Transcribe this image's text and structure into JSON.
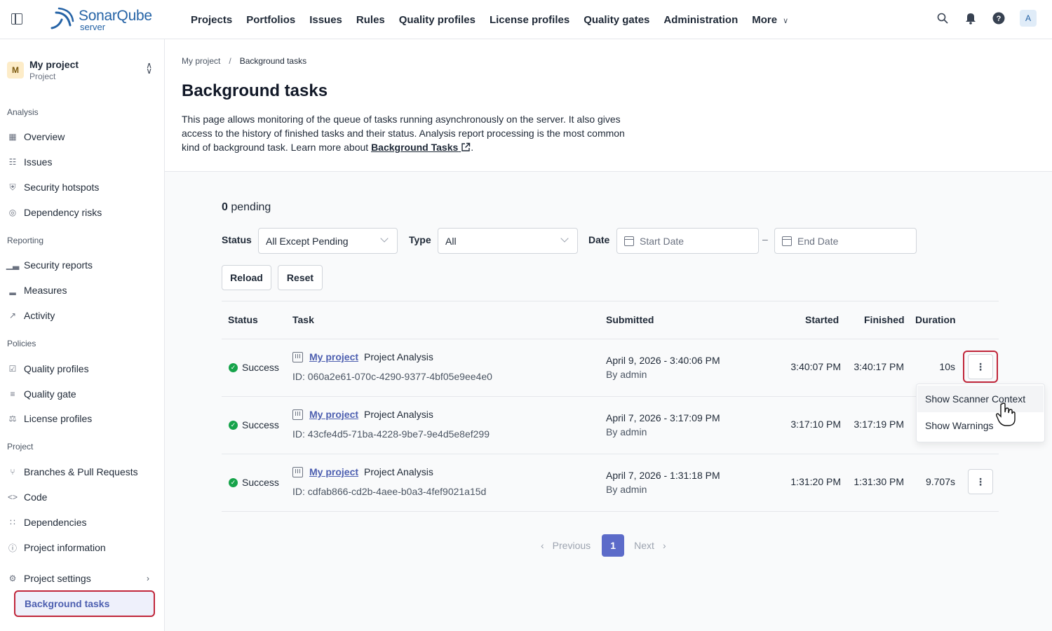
{
  "app": {
    "name": "SonarQube",
    "sub": "server",
    "brand_color": "#2563a6"
  },
  "nav": {
    "items": [
      "Projects",
      "Portfolios",
      "Issues",
      "Rules",
      "Quality profiles",
      "License profiles",
      "Quality gates",
      "Administration"
    ],
    "more": "More",
    "icons": [
      "search-icon",
      "bell-icon",
      "help-icon"
    ],
    "avatar": "A"
  },
  "project": {
    "avatar": "M",
    "name": "My project",
    "type": "Project"
  },
  "sidebar": {
    "sections": {
      "analysis": "Analysis",
      "reporting": "Reporting",
      "policies": "Policies",
      "project": "Project"
    },
    "items": {
      "overview": "Overview",
      "issues": "Issues",
      "hotspots": "Security hotspots",
      "dependency_risks": "Dependency risks",
      "security_reports": "Security reports",
      "measures": "Measures",
      "activity": "Activity",
      "quality_profiles": "Quality profiles",
      "quality_gate": "Quality gate",
      "license_profiles": "License profiles",
      "branches": "Branches & Pull Requests",
      "code": "Code",
      "dependencies": "Dependencies",
      "project_information": "Project information",
      "project_settings": "Project settings",
      "background_tasks": "Background tasks"
    }
  },
  "breadcrumb": {
    "root": "My project",
    "sep": "/",
    "current": "Background tasks"
  },
  "page": {
    "title": "Background tasks",
    "desc": "This page allows monitoring of the queue of tasks running asynchronously on the server. It also gives access to the history of finished tasks and their status. Analysis report processing is the most common kind of background task. Learn more about ",
    "desc_link": "Background Tasks",
    "desc_end": "."
  },
  "filters": {
    "pending_count": "0",
    "pending_label": "pending",
    "status_label": "Status",
    "status_value": "All Except Pending",
    "type_label": "Type",
    "type_value": "All",
    "date_label": "Date",
    "start_placeholder": "Start Date",
    "dash": "–",
    "end_placeholder": "End Date",
    "reload": "Reload",
    "reset": "Reset"
  },
  "table": {
    "headers": {
      "status": "Status",
      "task": "Task",
      "submitted": "Submitted",
      "started": "Started",
      "finished": "Finished",
      "duration": "Duration"
    },
    "rows": [
      {
        "status": "Success",
        "project": "My project",
        "task": "Project Analysis",
        "id": "ID: 060a2e61-070c-4290-9377-4bf05e9ee4e0",
        "submitted": "April 9, 2026 - 3:40:06 PM",
        "by": "By admin",
        "started": "3:40:07 PM",
        "finished": "3:40:17 PM",
        "duration": "10s"
      },
      {
        "status": "Success",
        "project": "My project",
        "task": "Project Analysis",
        "id": "ID: 43cfe4d5-71ba-4228-9be7-9e4d5e8ef299",
        "submitted": "April 7, 2026 - 3:17:09 PM",
        "by": "By admin",
        "started": "3:17:10 PM",
        "finished": "3:17:19 PM",
        "duration": ""
      },
      {
        "status": "Success",
        "project": "My project",
        "task": "Project Analysis",
        "id": "ID: cdfab866-cd2b-4aee-b0a3-4fef9021a15d",
        "submitted": "April 7, 2026 - 1:31:18 PM",
        "by": "By admin",
        "started": "1:31:20 PM",
        "finished": "1:31:30 PM",
        "duration": "9.707s"
      }
    ]
  },
  "menu": {
    "scanner_context": "Show Scanner Context",
    "warnings": "Show Warnings"
  },
  "pager": {
    "prev": "Previous",
    "page": "1",
    "next": "Next"
  },
  "colors": {
    "accent": "#5c6bc9",
    "highlight": "#c0263a",
    "success": "#16a34a"
  }
}
